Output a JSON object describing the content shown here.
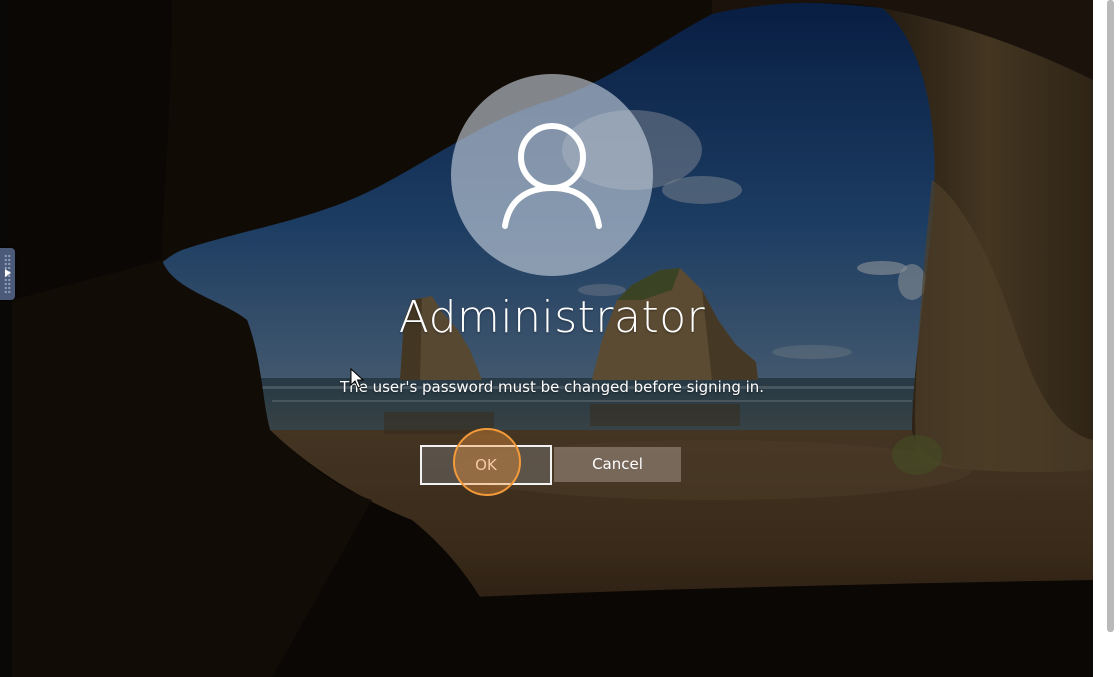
{
  "lock_screen": {
    "user_name": "Administrator",
    "message": "The user's password must be changed before signing in.",
    "buttons": {
      "ok_label": "OK",
      "cancel_label": "Cancel"
    }
  },
  "icons": {
    "avatar": "user-silhouette-icon",
    "side_handle": "drawer-expand-arrow-icon",
    "cursor": "mouse-pointer-icon"
  },
  "colors": {
    "click_highlight": "#f39a3a",
    "ok_border": "#f2f2f2",
    "cancel_bg": "#968779",
    "side_handle": "#4a5a78"
  }
}
